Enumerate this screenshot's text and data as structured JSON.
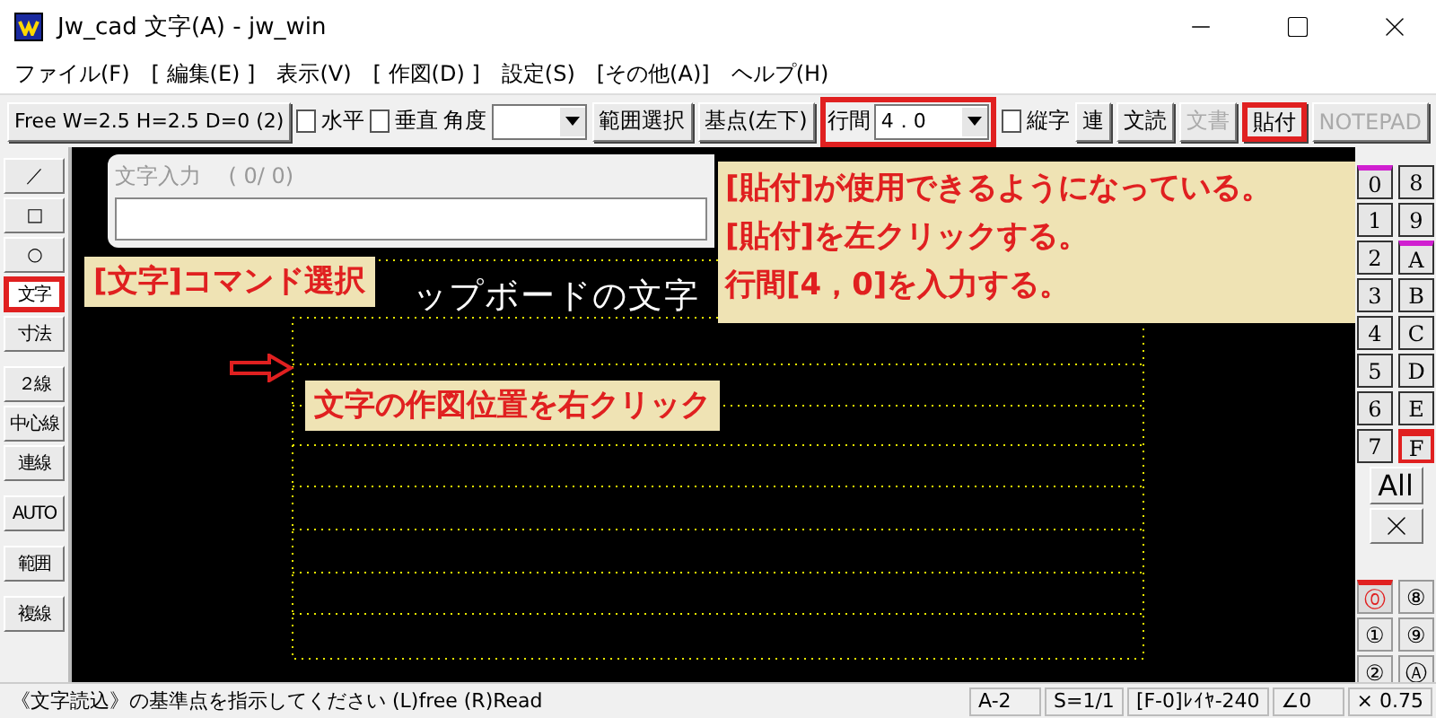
{
  "window": {
    "title": "Jw_cad 文字(A) - jw_win"
  },
  "menu": [
    "ファイル(F)",
    "[ 編集(E) ]",
    "表示(V)",
    "[ 作図(D) ]",
    "設定(S)",
    "[その他(A)]",
    "ヘルプ(H)"
  ],
  "toolbar": {
    "mode_button": "Free  W=2.5 H=2.5 D=0 (2)",
    "checks": [
      {
        "label": "水平",
        "checked": false
      },
      {
        "label": "垂直",
        "checked": false
      }
    ],
    "angle_label": "角度",
    "range_button": "範囲選択",
    "base_button": "基点(左下)",
    "spacing": {
      "label": "行間",
      "value": "4．0",
      "highlighted": true
    },
    "vertical": {
      "label": "縦字",
      "checked": false
    },
    "buttons": [
      {
        "label": "連",
        "disabled": false,
        "highlighted": false
      },
      {
        "label": "文読",
        "disabled": false,
        "highlighted": false
      },
      {
        "label": "文書",
        "disabled": true,
        "highlighted": false
      },
      {
        "label": "貼付",
        "disabled": false,
        "highlighted": true
      },
      {
        "label": "NOTEPAD",
        "disabled": true,
        "highlighted": false
      }
    ]
  },
  "tool_groups": [
    [
      {
        "label": "／",
        "selected": false,
        "highlighted": false
      },
      {
        "label": "□",
        "selected": false,
        "highlighted": false
      },
      {
        "label": "○",
        "selected": false,
        "highlighted": false
      },
      {
        "label": "文字",
        "selected": true,
        "highlighted": true
      },
      {
        "label": "寸法",
        "selected": false,
        "highlighted": false
      }
    ],
    [
      {
        "label": "２線",
        "selected": false,
        "highlighted": false
      },
      {
        "label": "中心線",
        "selected": false,
        "highlighted": false
      },
      {
        "label": "連線",
        "selected": false,
        "highlighted": false
      }
    ],
    [
      {
        "label": "AUTO",
        "selected": false,
        "highlighted": false
      }
    ],
    [
      {
        "label": "範囲",
        "selected": false,
        "highlighted": false
      }
    ],
    [
      {
        "label": "複線",
        "selected": false,
        "highlighted": false
      }
    ]
  ],
  "text_dialog": {
    "title": "文字入力",
    "count": "( 0/ 0)"
  },
  "canvas": {
    "text": "ップボードの文字"
  },
  "instruction_note": {
    "lines": [
      "[貼付]が使用できるようになっている。",
      "[貼付]を左クリックする。",
      "行間[4，0]を入力する。"
    ]
  },
  "annotations": [
    {
      "kind": "callout",
      "text": "[文字]コマンド選択"
    },
    {
      "kind": "arrow"
    },
    {
      "kind": "callout",
      "text": "文字の作図位置を右クリック"
    }
  ],
  "layer_groups": [
    {
      "label": "0",
      "selected": false,
      "marked": true
    },
    {
      "label": "8",
      "selected": false,
      "marked": false
    },
    {
      "label": "1",
      "selected": false,
      "marked": false
    },
    {
      "label": "9",
      "selected": false,
      "marked": false
    },
    {
      "label": "2",
      "selected": false,
      "marked": false
    },
    {
      "label": "A",
      "selected": false,
      "marked": true
    },
    {
      "label": "3",
      "selected": false,
      "marked": false
    },
    {
      "label": "B",
      "selected": false,
      "marked": false
    },
    {
      "label": "4",
      "selected": false,
      "marked": false
    },
    {
      "label": "C",
      "selected": false,
      "marked": false
    },
    {
      "label": "5",
      "selected": false,
      "marked": false
    },
    {
      "label": "D",
      "selected": false,
      "marked": false
    },
    {
      "label": "6",
      "selected": false,
      "marked": false
    },
    {
      "label": "E",
      "selected": false,
      "marked": false
    },
    {
      "label": "7",
      "selected": false,
      "marked": false
    },
    {
      "label": "F",
      "selected": true,
      "marked": false
    }
  ],
  "all_button": "All",
  "layers": [
    {
      "label": "⓪",
      "selected": true
    },
    {
      "label": "⑧",
      "selected": false
    },
    {
      "label": "①",
      "selected": false
    },
    {
      "label": "⑨",
      "selected": false
    },
    {
      "label": "②",
      "selected": false
    },
    {
      "label": "Ⓐ",
      "selected": false
    }
  ],
  "status_bar": {
    "message": "《文字読込》の基準点を指示してください (L)free (R)Read",
    "fields": [
      "A-2",
      "S=1/1",
      "[F-0]ﾚｲﾔ-240",
      "∠0",
      "× 0.75"
    ]
  }
}
